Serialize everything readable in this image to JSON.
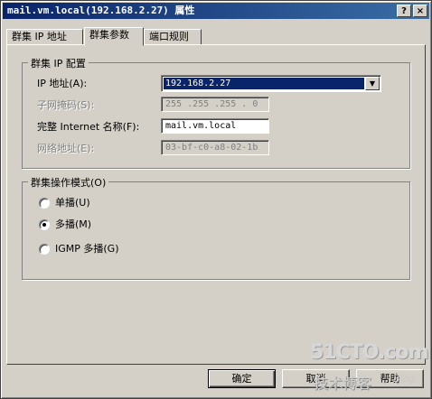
{
  "window": {
    "title": "mail.vm.local(192.168.2.27) 属性",
    "help_btn": "?",
    "close_btn": "×"
  },
  "tabs": [
    {
      "label": "群集 IP 地址",
      "active": false
    },
    {
      "label": "群集参数",
      "active": true
    },
    {
      "label": "端口规则",
      "active": false
    }
  ],
  "ip_config": {
    "legend": "群集 IP 配置",
    "ip_label": "IP 地址(A):",
    "ip_value": "192.168.2.27",
    "mask_label": "子网掩码(S):",
    "mask_value": "255 .255 .255 . 0",
    "fqdn_label": "完整 Internet 名称(F):",
    "fqdn_value": "mail.vm.local",
    "mac_label": "网络地址(E):",
    "mac_value": "03-bf-c0-a8-02-1b"
  },
  "mode": {
    "legend": "群集操作模式(O)",
    "options": [
      {
        "label": "单播(U)",
        "selected": false
      },
      {
        "label": "多播(M)",
        "selected": true
      },
      {
        "label": "IGMP 多播(G)",
        "selected": false
      }
    ]
  },
  "buttons": {
    "ok": "确定",
    "cancel": "取消",
    "help": "帮助"
  },
  "watermark": {
    "line1": "51CTO.com",
    "line2": "技术博客",
    "line3": "Blog"
  },
  "colors": {
    "face": "#d4d0c8",
    "title_bar": "#0a246a",
    "selection": "#0a246a"
  },
  "icons": {
    "combo_arrow": "chevron-down-icon"
  }
}
